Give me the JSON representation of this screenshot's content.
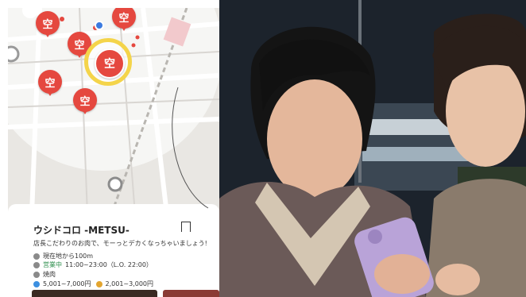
{
  "map": {
    "pin_label": "空",
    "pins": [
      {
        "id": "pin-1"
      },
      {
        "id": "pin-2"
      },
      {
        "id": "pin-3"
      },
      {
        "id": "pin-4"
      },
      {
        "id": "pin-5"
      },
      {
        "id": "pin-selected"
      }
    ]
  },
  "card": {
    "shop_name": "ウシドコロ -METSU-",
    "description": "店長こだわりのお肉で、モーっとデカくなっちゃいましょう!",
    "distance": "現在地から100m",
    "status": "営業中",
    "hours": "11:00~23:00（L.O. 22:00）",
    "genre": "焼肉",
    "price_dinner": "5,001~7,000円",
    "price_lunch": "2,001~3,000円"
  },
  "colors": {
    "pin_red": "#e5483f",
    "selected_ring": "#f4d44a",
    "open_green": "#2a8d4a",
    "current_location_blue": "#3c7be0"
  }
}
